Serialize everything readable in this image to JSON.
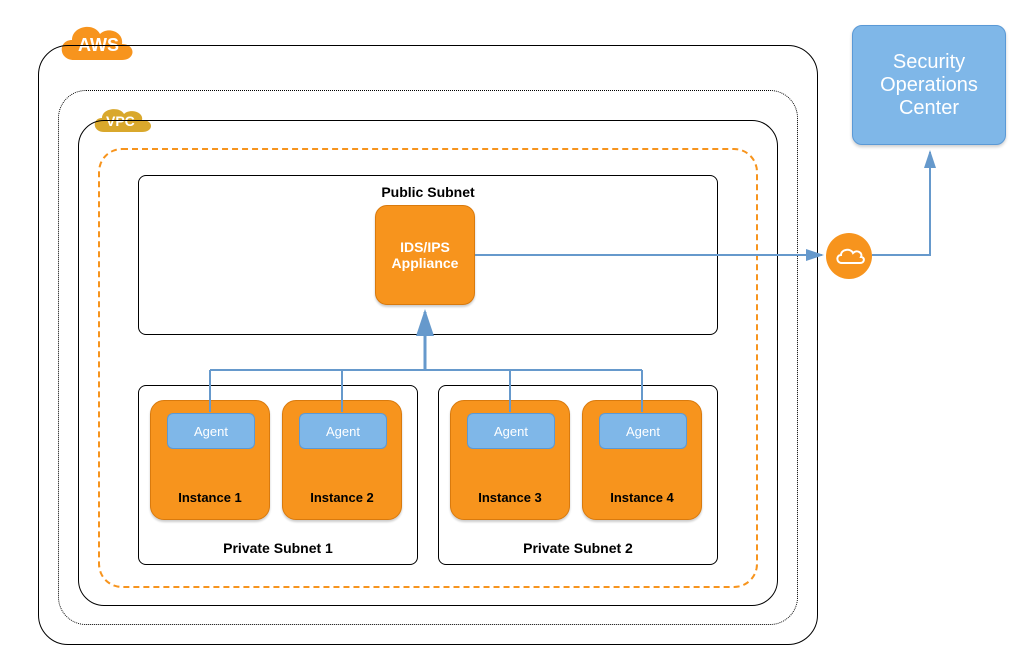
{
  "aws": {
    "label": "AWS"
  },
  "vpc": {
    "label": "VPC"
  },
  "public_subnet": {
    "label": "Public Subnet"
  },
  "ids": {
    "label": "IDS/IPS\nAppliance"
  },
  "private_subnets": [
    {
      "label": "Private Subnet 1"
    },
    {
      "label": "Private Subnet 2"
    }
  ],
  "instances": [
    {
      "label": "Instance 1",
      "agent": "Agent"
    },
    {
      "label": "Instance 2",
      "agent": "Agent"
    },
    {
      "label": "Instance 3",
      "agent": "Agent"
    },
    {
      "label": "Instance 4",
      "agent": "Agent"
    }
  ],
  "soc": {
    "label": "Security Operations Center"
  },
  "colors": {
    "orange": "#F7941D",
    "blue": "#7FB7E8",
    "vpc_gold": "#D9A82C",
    "arrow": "#6699CC"
  }
}
